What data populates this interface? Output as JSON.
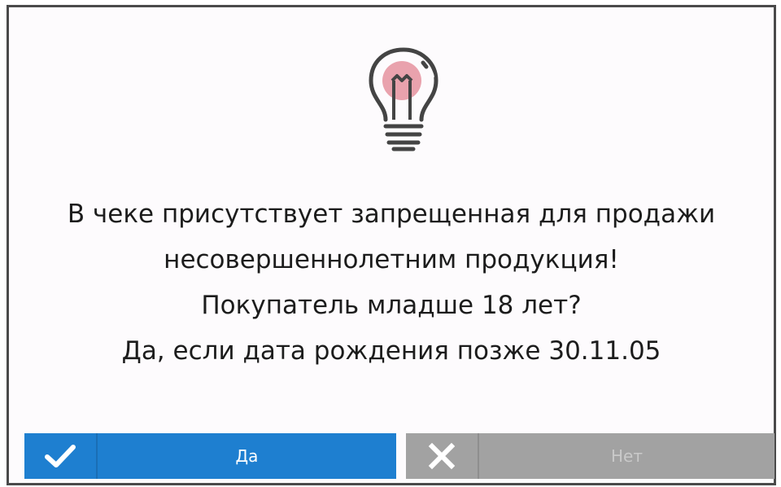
{
  "dialog": {
    "icon": "lightbulb-icon",
    "message_lines": [
      "В чеке присутствует запрещенная для продажи",
      "несовершеннолетним продукция!",
      "Покупатель младше 18 лет?",
      "Да, если дата рождения позже 30.11.05"
    ]
  },
  "buttons": {
    "yes": {
      "label": "Да",
      "icon": "checkmark-icon",
      "color": "#1e7fd0"
    },
    "no": {
      "label": "Нет",
      "icon": "close-icon",
      "color": "#a2a2a2"
    }
  },
  "colors": {
    "bulb_glow": "#e9a2ad",
    "border": "#4a4a4a"
  }
}
